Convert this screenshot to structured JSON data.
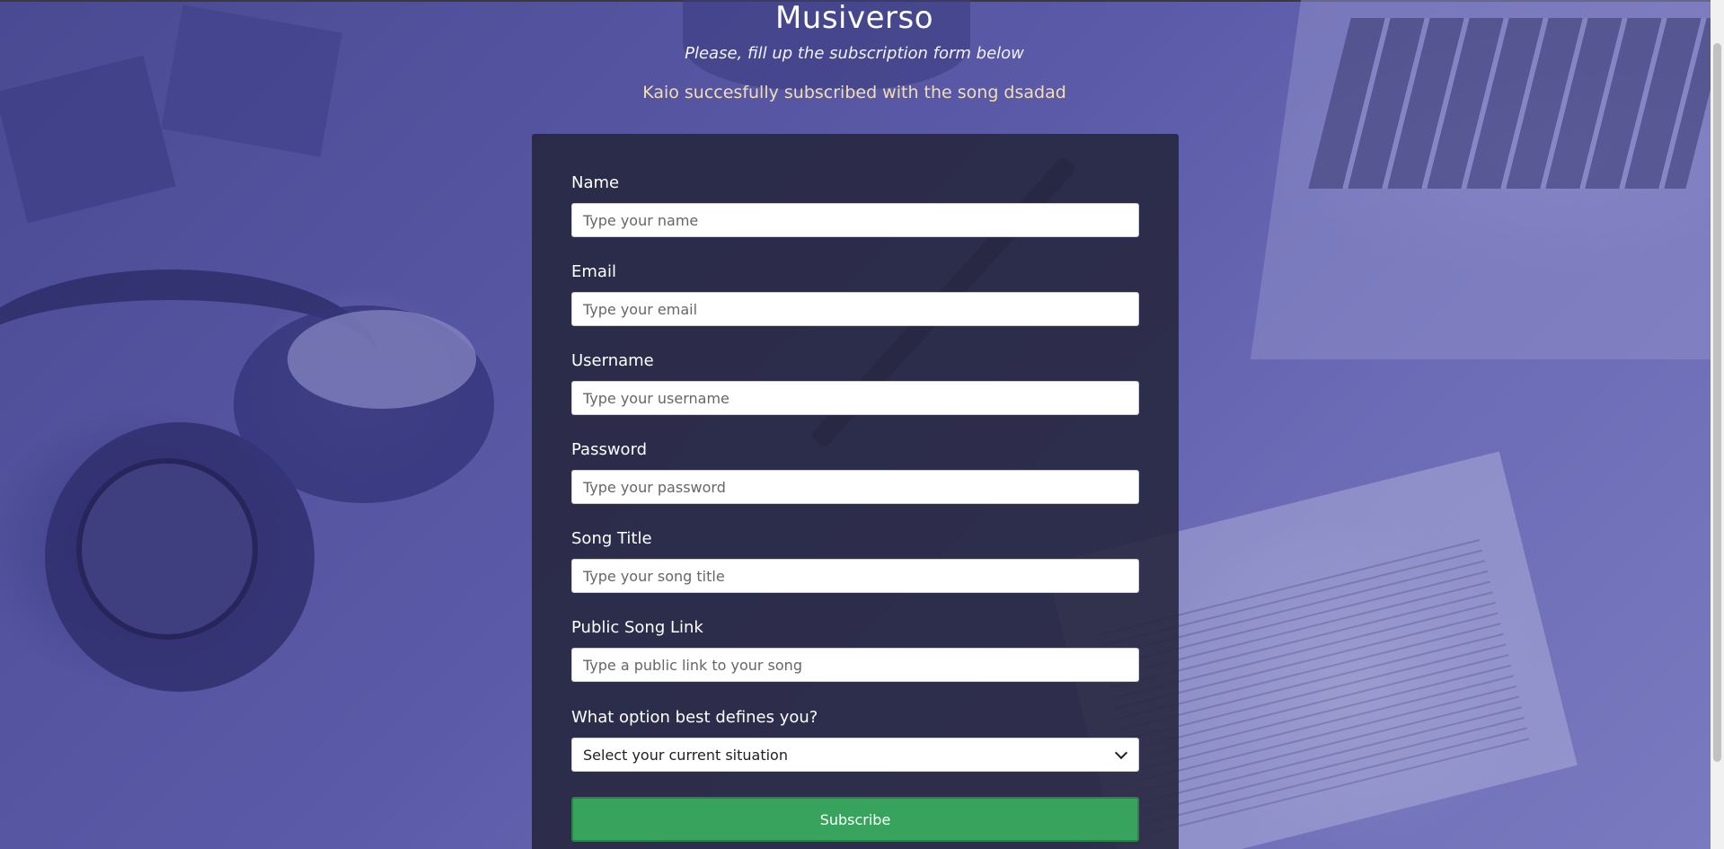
{
  "header": {
    "title": "Musiverso",
    "subtitle": "Please, fill up the subscription form below",
    "success_message": "Kaio succesfully subscribed with the song dsadad"
  },
  "form": {
    "fields": [
      {
        "label": "Name",
        "placeholder": "Type your name"
      },
      {
        "label": "Email",
        "placeholder": "Type your email"
      },
      {
        "label": "Username",
        "placeholder": "Type your username"
      },
      {
        "label": "Password",
        "placeholder": "Type your password"
      },
      {
        "label": "Song Title",
        "placeholder": "Type your song title"
      },
      {
        "label": "Public Song Link",
        "placeholder": "Type a public link to your song"
      }
    ],
    "situation": {
      "label": "What option best defines you?",
      "selected": "Select your current situation"
    },
    "submit_label": "Subscribe"
  },
  "colors": {
    "success_text": "#f3dfae",
    "submit_button": "#37a35c",
    "card_background": "#26263e"
  }
}
